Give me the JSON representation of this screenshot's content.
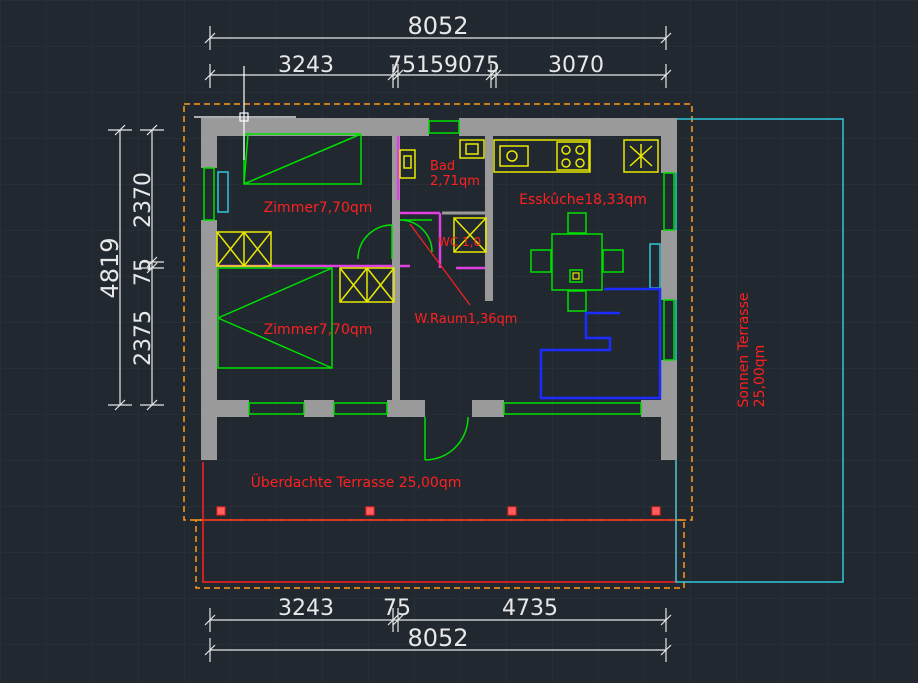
{
  "dimensions": {
    "top_total": "8052",
    "top_left": "3243",
    "top_mid": "75159075",
    "top_right": "3070",
    "bottom_left": "3243",
    "bottom_mid": "75",
    "bottom_right": "4735",
    "bottom_total": "8052",
    "left_total": "4819",
    "left_upper": "2370",
    "left_mid": "75",
    "left_lower": "2375"
  },
  "rooms": {
    "zimmer1": "Zimmer7,70qm",
    "zimmer2": "Zimmer7,70qm",
    "bad_name": "Bad",
    "bad_area": "2,71qm",
    "wc": "WC 1,0",
    "wroom": "W.Raum1,36qm",
    "kitchen": "Esskûche18,33qm",
    "terrace_covered": "Überdachte Terrasse 25,00qm",
    "terrace_sun_name": "Sonnen Terrasse",
    "terrace_sun_area": "25,00qm"
  },
  "colors": {
    "background": "#212830",
    "grid": "#2c343d",
    "dimension": "#e8e8e8",
    "wall": "#9a9a9a",
    "room_text": "#ff2020",
    "furniture": "#00e000",
    "fixtures": "#e8e800",
    "partition": "#e040e0",
    "counter": "#1a2cff",
    "outline": "#ff9a1a",
    "sun_terrace": "#30c8d8"
  }
}
